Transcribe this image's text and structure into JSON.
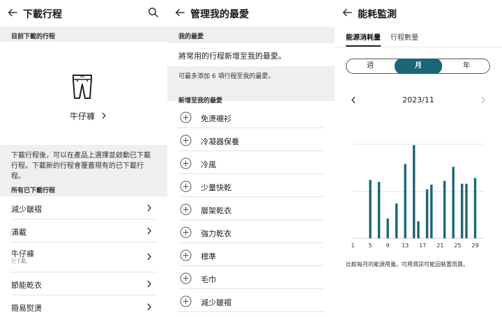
{
  "panel1": {
    "title": "下載行程",
    "current_header": "目前下載的行程",
    "featured": {
      "name": "牛仔褲",
      "icon": "pants-icon"
    },
    "description": "下載行程後，可以在產品上選擇並啟動已下載行程。下載新的行程會覆蓋現有的已下載行程。",
    "all_header": "所有已下載行程",
    "items": [
      {
        "label": "減少皺褶",
        "sub": ""
      },
      {
        "label": "滿載",
        "sub": ""
      },
      {
        "label": "牛仔褲",
        "sub": "已下載。"
      },
      {
        "label": "節能乾衣",
        "sub": ""
      },
      {
        "label": "簡易熨燙",
        "sub": ""
      }
    ]
  },
  "panel2": {
    "title": "管理我的最愛",
    "fav_header": "我的最愛",
    "hint": "將常用的行程新增至我的最愛。",
    "limit": "可最多添加 6 項行程至我的最愛。",
    "add_header": "新增至我的最愛",
    "items": [
      "免燙襯衫",
      "冷凝器保養",
      "冷風",
      "少量快乾",
      "層架乾衣",
      "強力乾衣",
      "標準",
      "毛巾",
      "減少皺褶"
    ]
  },
  "panel3": {
    "title": "能耗監測",
    "tabs": [
      "能源消耗量",
      "行程數量"
    ],
    "segments": [
      "週",
      "月",
      "年"
    ],
    "selected_segment": "月",
    "month": "2023/11",
    "note": "比較每月的能源用量。可用資訊可能因裝置而異。",
    "accent": "#1a6678"
  },
  "chart_data": {
    "type": "bar",
    "x_tick_labels": [
      "1",
      "5",
      "9",
      "13",
      "17",
      "21",
      "25",
      "29"
    ],
    "x": [
      5,
      6,
      8,
      9,
      10,
      11,
      13,
      14,
      15,
      16,
      18,
      19,
      20,
      22,
      23,
      25,
      26,
      28,
      29
    ],
    "values": [
      0.62,
      0.6,
      0.0,
      0.21,
      0.37,
      0.79,
      0.99,
      0.18,
      0.52,
      0.57,
      0.61,
      0.76,
      0.0,
      0.58,
      0.58,
      0.0,
      0.64,
      0.0,
      0.0
    ],
    "bars": [
      {
        "day": 5,
        "value": 0.62
      },
      {
        "day": 7,
        "value": 0.6
      },
      {
        "day": 9,
        "value": 0.21
      },
      {
        "day": 11,
        "value": 0.37
      },
      {
        "day": 13,
        "value": 0.79
      },
      {
        "day": 15,
        "value": 0.99
      },
      {
        "day": 16,
        "value": 0.18
      },
      {
        "day": 18,
        "value": 0.52
      },
      {
        "day": 19,
        "value": 0.57
      },
      {
        "day": 22,
        "value": 0.61
      },
      {
        "day": 24,
        "value": 0.76
      },
      {
        "day": 26,
        "value": 0.58
      },
      {
        "day": 27,
        "value": 0.58
      },
      {
        "day": 29,
        "value": 0.64
      }
    ],
    "xlim": [
      1,
      31
    ],
    "ylim": [
      0,
      1.2
    ],
    "grid": true,
    "color": "#1a6678"
  }
}
